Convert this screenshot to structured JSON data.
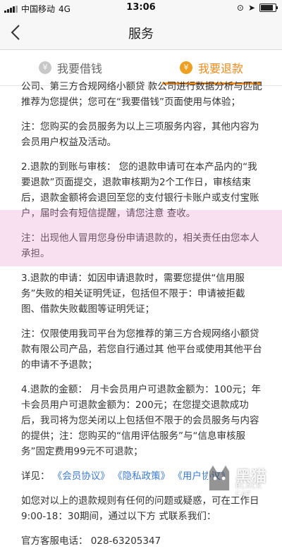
{
  "status_bar": {
    "carrier": "中国移动",
    "network": "4G",
    "time": "13:06"
  },
  "header": {
    "title": "服务",
    "back_icon": "chevron-left-icon"
  },
  "tabs": [
    {
      "label": "我要借钱",
      "icon": "yen-coin-icon",
      "active": false
    },
    {
      "label": "我要退款",
      "icon": "refund-coin-icon",
      "active": true
    }
  ],
  "accent_color": "#ee8a1a",
  "content": {
    "p1": "公司、第三方合规网络小额贷 款公司进行数据分析与匹配推荐为您提供；您可在“我要借钱”页面使用与体验；",
    "p2": "注：您购买的会员服务为以上三项服务内容，其他内容为会员用户权益及活动。",
    "p3": "2.退款的到账与审核： 您的退款申请可在本产品内的“我要退款”页面提交，退款审核期为2个工作日，审核结束后，退款金额将会退回至您的支付银行卡账户或支付宝账户，届时会有短信提醒，请您注意 查收。",
    "p4": "注：出现他人冒用您身份申请退款的，相关责任由您本人承担。",
    "p5": "3.退款的申请：如因申请退款时，需要您提供“信用服务”失败的相关证明凭证，包括但不限于：申请被拒截图、借款失败截图等证明凭证；",
    "p6": "注：仅限使用我司平台为您推荐的第三方合规网络小额贷款有限公司产品，若您自行通过其 他平台或使用其他平台的申请不予退款；",
    "p7": "4.退款的金额： 月卡会员用户可退款金额为：100元；年卡会员用户可退款金额为：200元；在您提交退款成功后，我司将为您关闭以上包括但不限于的会员服务与内容的提供；注：您购买的“信用评估服务”与“信息审核服务”固定费用99元不可退款；",
    "details_label": "详见：",
    "links": [
      "《会员协议》",
      "《隐私政策》",
      "《用户协议》"
    ],
    "p8": "如您对以上的退款规则有任何的问题或疑惑，可在工作日9:00-18：30期间，通过以下方 式联系我们：",
    "hotline": "官方客服电话： 028-63205347"
  },
  "watermark": {
    "brand_cn": "黑猫",
    "brand_en": "BLACK CAT"
  }
}
